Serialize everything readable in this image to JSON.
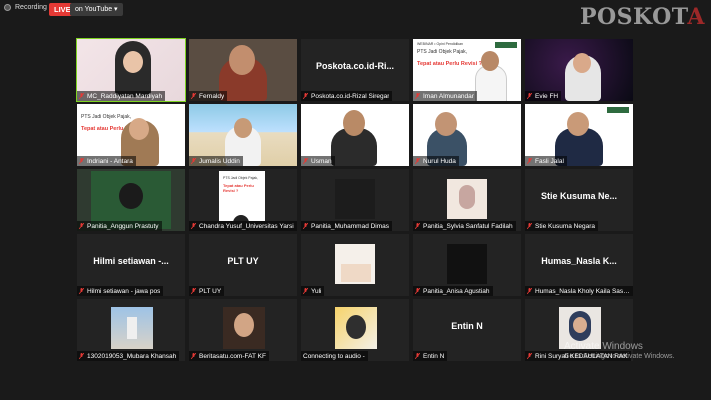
{
  "topbar": {
    "recording_label": "Recording",
    "live_label": "LIVE",
    "platform_label": "on YouTube ▾",
    "logo_text_a": "POSKOT",
    "logo_text_b": "A"
  },
  "slide": {
    "header": "WEBINAR • Opini Pendidikan",
    "title": "PTS Jadi Objek Pajak,",
    "question": "Tepat atau Perlu Revisi ?"
  },
  "participants": [
    {
      "name": "MC_Raddiyatan Mardiyah",
      "type": "video",
      "active": true
    },
    {
      "name": "Fernaldy",
      "type": "video"
    },
    {
      "name": "Poskota.co.id-Rizal Siregar",
      "type": "name_card",
      "display": "Poskota.co.id-Ri..."
    },
    {
      "name": "Iman Almunandar",
      "type": "video"
    },
    {
      "name": "Evie FH",
      "type": "video"
    },
    {
      "name": "Indriani - Antara",
      "type": "video"
    },
    {
      "name": "Jumalis Uddin",
      "type": "video"
    },
    {
      "name": "Usman",
      "type": "video"
    },
    {
      "name": "Nurul Huda",
      "type": "video"
    },
    {
      "name": "Fasli Jalal",
      "type": "video"
    },
    {
      "name": "Panitia_Anggun Prastuty",
      "type": "video"
    },
    {
      "name": "Chandra Yusuf_Universitas Yarsi",
      "type": "video"
    },
    {
      "name": "Panitia_Muhammad Dimas",
      "type": "dark"
    },
    {
      "name": "Panitia_Sylvia Sanfatul Fadilah",
      "type": "avatar"
    },
    {
      "name": "Stie Kusuma Negara",
      "type": "name_card",
      "display": "Stie Kusuma Ne..."
    },
    {
      "name": "Hilmi setiawan - jawa pos",
      "type": "name_card",
      "display": "Hilmi setiawan -..."
    },
    {
      "name": "PLT UY",
      "type": "name_card",
      "display": "PLT UY"
    },
    {
      "name": "Yuli",
      "type": "avatar"
    },
    {
      "name": "Panitia_Anisa Agustiah",
      "type": "dark"
    },
    {
      "name": "Humas_Nasla Kholy Kaila Sasya",
      "type": "name_card",
      "display": "Humas_Nasla K..."
    },
    {
      "name": "1302019053_Mubara Khansah",
      "type": "avatar"
    },
    {
      "name": "Beritasatu.com-FAT KF",
      "type": "avatar"
    },
    {
      "name": "Connecting to audio -",
      "type": "avatar"
    },
    {
      "name": "Entin N",
      "type": "name_card",
      "display": "Entin N"
    },
    {
      "name": "Rini Suryati KEDAULATAN RAK",
      "type": "avatar"
    }
  ],
  "watermark": {
    "line1": "Activate Windows",
    "line2": "Go to Settings to activate Windows."
  },
  "colors": {
    "background": "#1a1a1a",
    "tile": "#232323",
    "active_border": "#7ed321",
    "live_red": "#e53935",
    "mic_muted": "#e53935"
  }
}
